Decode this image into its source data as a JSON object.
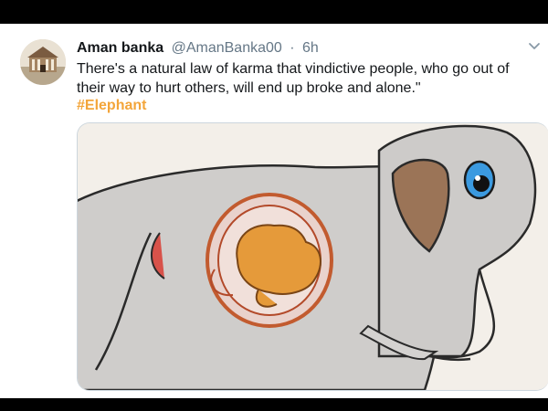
{
  "tweet": {
    "author_name": "Aman banka",
    "handle": "@AmanBanka00",
    "separator": "·",
    "time": "6h",
    "text": "There's a natural law of karma that vindictive people, who go out of their way to hurt others, will end up broke and alone.\"",
    "hashtag": "#Elephant"
  },
  "icons": {
    "menu": "chevron-down-icon",
    "avatar": "avatar"
  },
  "colors": {
    "hashtag": "#f3a53a",
    "meta": "#657786",
    "text": "#14171a",
    "background": "#000000"
  }
}
